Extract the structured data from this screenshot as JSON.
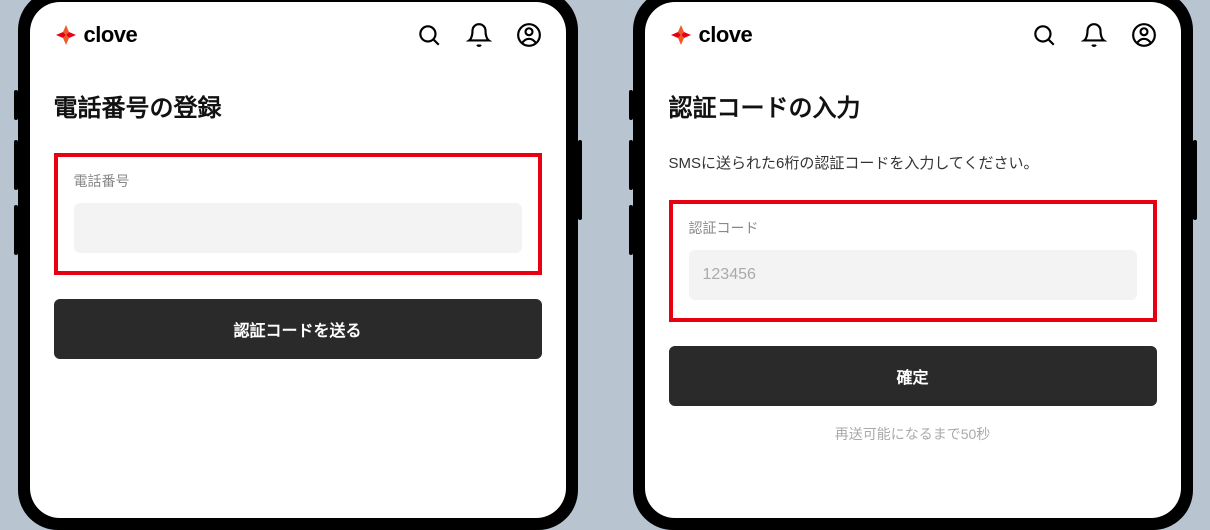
{
  "brand": {
    "name": "clove"
  },
  "screens": [
    {
      "title": "電話番号の登録",
      "subtitle": "",
      "input": {
        "label": "電話番号",
        "value": "",
        "placeholder": ""
      },
      "button": "認証コードを送る",
      "resend": ""
    },
    {
      "title": "認証コードの入力",
      "subtitle": "SMSに送られた6桁の認証コードを入力してください。",
      "input": {
        "label": "認証コード",
        "value": "",
        "placeholder": "123456"
      },
      "button": "確定",
      "resend": "再送可能になるまで50秒"
    }
  ]
}
